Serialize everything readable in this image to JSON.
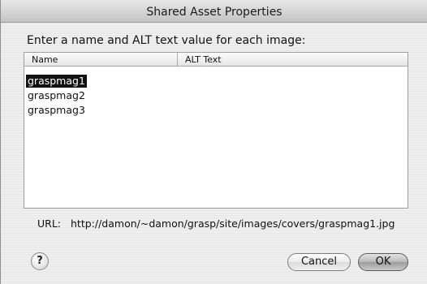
{
  "window": {
    "title": "Shared Asset Properties"
  },
  "prompt": "Enter a name and ALT text value for each image:",
  "table": {
    "columns": [
      "Name",
      "ALT Text"
    ],
    "rows": [
      {
        "name": "graspmag1",
        "alt": "",
        "selected": true
      },
      {
        "name": "graspmag2",
        "alt": "",
        "selected": false
      },
      {
        "name": "graspmag3",
        "alt": "",
        "selected": false
      }
    ]
  },
  "url": {
    "label": "URL:",
    "value": "http://damon/~damon/grasp/site/images/covers/graspmag1.jpg"
  },
  "buttons": {
    "help": "?",
    "cancel": "Cancel",
    "ok": "OK"
  }
}
